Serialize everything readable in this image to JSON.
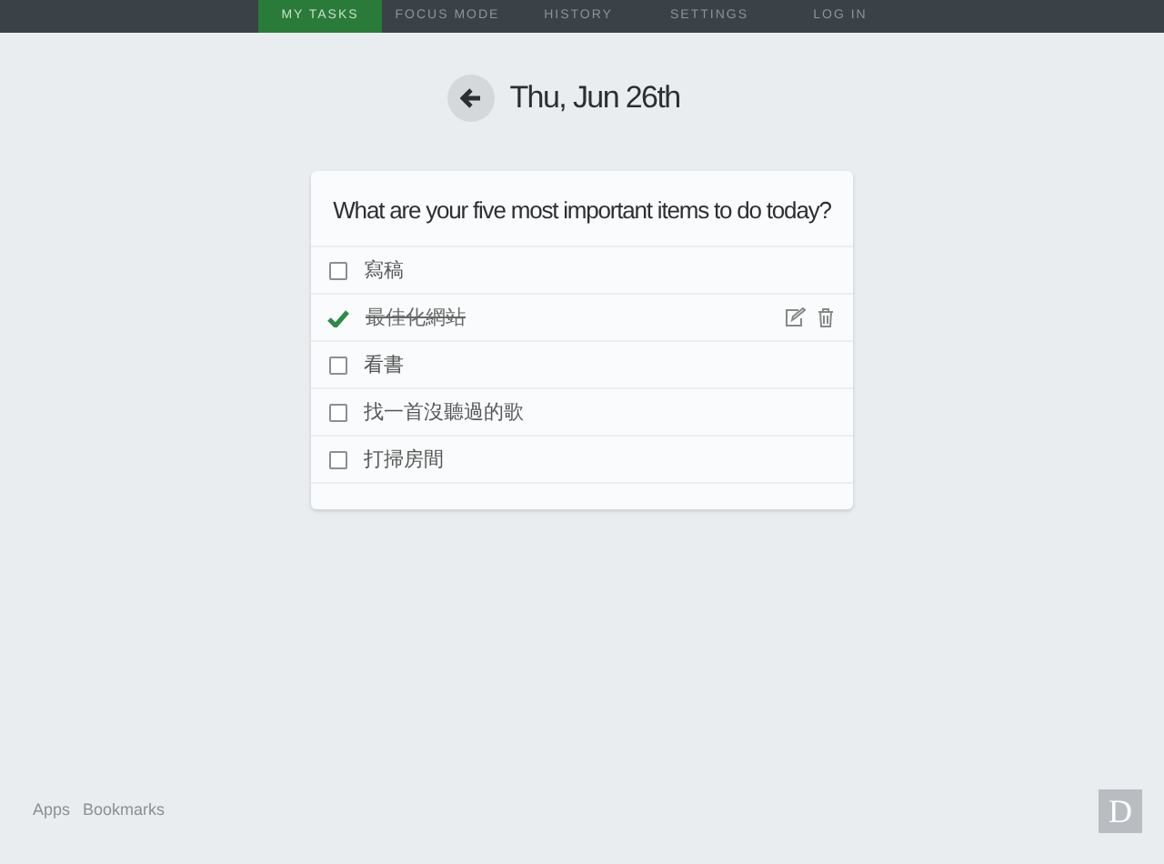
{
  "nav": [
    {
      "label": "MY TASKS",
      "selected": true
    },
    {
      "label": "FOCUS MODE",
      "selected": false
    },
    {
      "label": "HISTORY",
      "selected": false
    },
    {
      "label": "SETTINGS",
      "selected": false
    },
    {
      "label": "LOG IN",
      "selected": false
    }
  ],
  "date": "Thu, Jun 26th",
  "card": {
    "question": "What are your five most important items to do today?",
    "tasks": [
      {
        "text": "寫稿",
        "checked": false,
        "hovered": false
      },
      {
        "text": "最佳化網站",
        "checked": true,
        "hovered": true
      },
      {
        "text": "看書",
        "checked": false,
        "hovered": false
      },
      {
        "text": "找一首沒聽過的歌",
        "checked": false,
        "hovered": false
      },
      {
        "text": "打掃房間",
        "checked": false,
        "hovered": false
      }
    ]
  },
  "footer_links": [
    "Apps",
    "Bookmarks"
  ],
  "badge": "D"
}
